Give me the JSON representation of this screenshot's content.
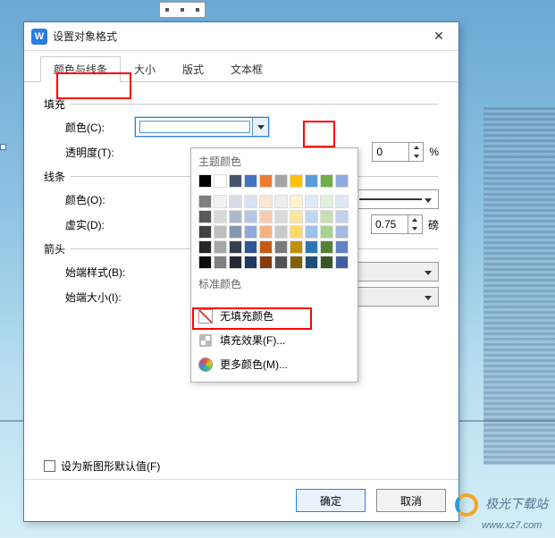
{
  "dialog": {
    "title": "设置对象格式",
    "tabs": {
      "color_line": "颜色与线条",
      "size": "大小",
      "layout": "版式",
      "textbox": "文本框"
    }
  },
  "sections": {
    "fill": "填充",
    "line": "线条",
    "arrow": "箭头"
  },
  "fields": {
    "fill_color": "颜色(C):",
    "transparency": "透明度(T):",
    "line_color": "颜色(O):",
    "dash": "虚实(D):",
    "start_style": "始端样式(B):",
    "start_size": "始端大小(I):"
  },
  "color_panel": {
    "theme_header": "主题颜色",
    "standard_header": "标准颜色",
    "no_fill": "无填充颜色",
    "fill_effects": "填充效果(F)...",
    "more_colors": "更多颜色(M)..."
  },
  "values": {
    "transparency_value": "0",
    "transparency_unit": "%",
    "line_weight_value": "0.75",
    "line_weight_unit": "磅"
  },
  "checkbox": {
    "set_default": "设为新图形默认值(F)"
  },
  "buttons": {
    "ok": "确定",
    "cancel": "取消"
  },
  "watermark": {
    "text": "极光下载站",
    "url": "www.xz7.com"
  },
  "theme_colors_row1": [
    "#000000",
    "#ffffff",
    "#44546a",
    "#4472c4",
    "#ed7d31",
    "#a5a5a5",
    "#ffc000",
    "#5b9bd5",
    "#70ad47",
    "#8faadc"
  ],
  "theme_shades": [
    [
      "#7f7f7f",
      "#f2f2f2",
      "#d6dce5",
      "#d9e2f3",
      "#fbe5d6",
      "#ededed",
      "#fff2cc",
      "#deebf7",
      "#e2f0d9",
      "#e0e7f2"
    ],
    [
      "#595959",
      "#d9d9d9",
      "#adb9ca",
      "#b4c7e7",
      "#f8cbad",
      "#dbdbdb",
      "#ffe699",
      "#bdd7ee",
      "#c5e0b4",
      "#c2d1e8"
    ],
    [
      "#404040",
      "#bfbfbf",
      "#8497b0",
      "#8faadc",
      "#f4b183",
      "#c9c9c9",
      "#ffd966",
      "#9dc3e6",
      "#a9d18e",
      "#a4bade"
    ],
    [
      "#262626",
      "#a6a6a6",
      "#333f50",
      "#2f5597",
      "#c55a11",
      "#7b7b7b",
      "#bf9000",
      "#2e75b6",
      "#548235",
      "#6181c3"
    ],
    [
      "#0d0d0d",
      "#808080",
      "#222a35",
      "#1f3864",
      "#843c0c",
      "#525252",
      "#806000",
      "#1f4e79",
      "#385723",
      "#3f5fa1"
    ]
  ],
  "standard_colors": [
    "#c00000",
    "#ff0000",
    "#ffc000",
    "#ffff00",
    "#92d050",
    "#00b050",
    "#00b0f0",
    "#0070c0",
    "#002060",
    "#7030a0"
  ]
}
